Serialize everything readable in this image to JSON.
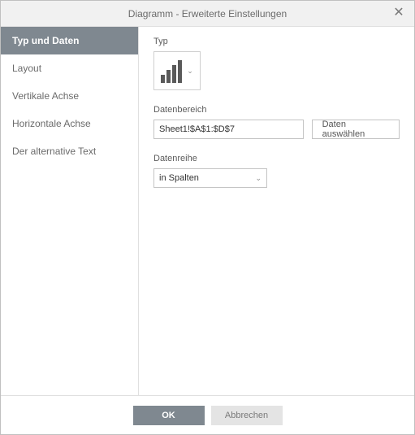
{
  "dialog": {
    "title": "Diagramm - Erweiterte Einstellungen"
  },
  "sidebar": {
    "items": [
      {
        "label": "Typ und Daten",
        "active": true
      },
      {
        "label": "Layout",
        "active": false
      },
      {
        "label": "Vertikale Achse",
        "active": false
      },
      {
        "label": "Horizontale Achse",
        "active": false
      },
      {
        "label": "Der alternative Text",
        "active": false
      }
    ]
  },
  "content": {
    "type_label": "Typ",
    "chart_type_icon": "bar-chart-icon",
    "data_range_label": "Datenbereich",
    "data_range_value": "Sheet1!$A$1:$D$7",
    "select_data_btn": "Daten auswählen",
    "data_series_label": "Datenreihe",
    "data_series_value": "in Spalten"
  },
  "footer": {
    "ok": "OK",
    "cancel": "Abbrechen"
  }
}
